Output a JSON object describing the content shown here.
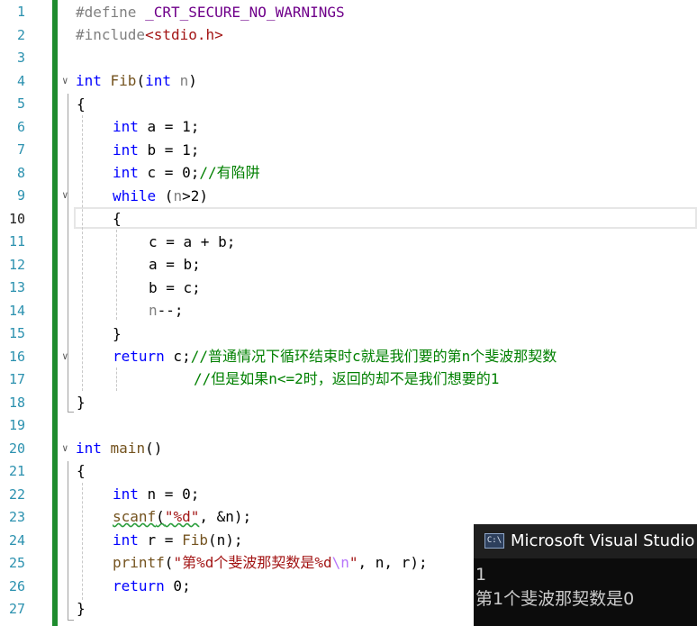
{
  "editor": {
    "line_numbers": [
      "1",
      "2",
      "3",
      "4",
      "5",
      "6",
      "7",
      "8",
      "9",
      "10",
      "11",
      "12",
      "13",
      "14",
      "15",
      "16",
      "17",
      "18",
      "19",
      "20",
      "21",
      "22",
      "23",
      "24",
      "25",
      "26",
      "27"
    ],
    "current_line": "10",
    "code": {
      "l1": {
        "pp": "#define",
        "name": " _CRT_SECURE_NO_WARNINGS"
      },
      "l2": {
        "pp": "#include",
        "hdr": "<stdio.h>"
      },
      "l4": {
        "kw1": "int",
        "fn": " Fib",
        "p1": "(",
        "kw2": "int",
        "param": " n",
        "p2": ")"
      },
      "l5": "{",
      "l6": {
        "kw": "int",
        "rest": " a = 1;"
      },
      "l7": {
        "kw": "int",
        "rest": " b = 1;"
      },
      "l8": {
        "kw": "int",
        "rest": " c = 0;",
        "cm": "//有陷阱"
      },
      "l9": {
        "kw": "while",
        "p1": " (",
        "param": "n",
        "rest": ">2)"
      },
      "l10": "{",
      "l11": "c = a + b;",
      "l12": "a = b;",
      "l13": "b = c;",
      "l14": {
        "param": "n",
        "rest": "--;"
      },
      "l15": "}",
      "l16": {
        "kw": "return",
        "rest": " c;",
        "cm": "//普通情况下循环结束时c就是我们要的第n个斐波那契数"
      },
      "l17": {
        "cm": "//但是如果n<=2时，返回的却不是我们想要的1"
      },
      "l18": "}",
      "l20": {
        "kw": "int",
        "fn": " main",
        "rest": "()"
      },
      "l21": "{",
      "l22": {
        "kw": "int",
        "rest": " n = 0;"
      },
      "l23": {
        "fn": "scanf",
        "p1": "(",
        "str": "\"%d\"",
        "rest": ", &n);"
      },
      "l24": {
        "kw": "int",
        "rest": " r = ",
        "fn": "Fib",
        "rest2": "(n);"
      },
      "l25": {
        "fn": "printf",
        "p1": "(",
        "str1": "\"第%d个斐波那契数是%d",
        "esc": "\\n",
        "str2": "\"",
        "rest": ", n, r);"
      },
      "l26": {
        "kw": "return",
        "rest": " 0;"
      },
      "l27": "}"
    }
  },
  "console": {
    "icon_label": "C:\\",
    "title": "Microsoft Visual Studio i",
    "output": [
      "1",
      "第1个斐波那契数是0"
    ]
  }
}
